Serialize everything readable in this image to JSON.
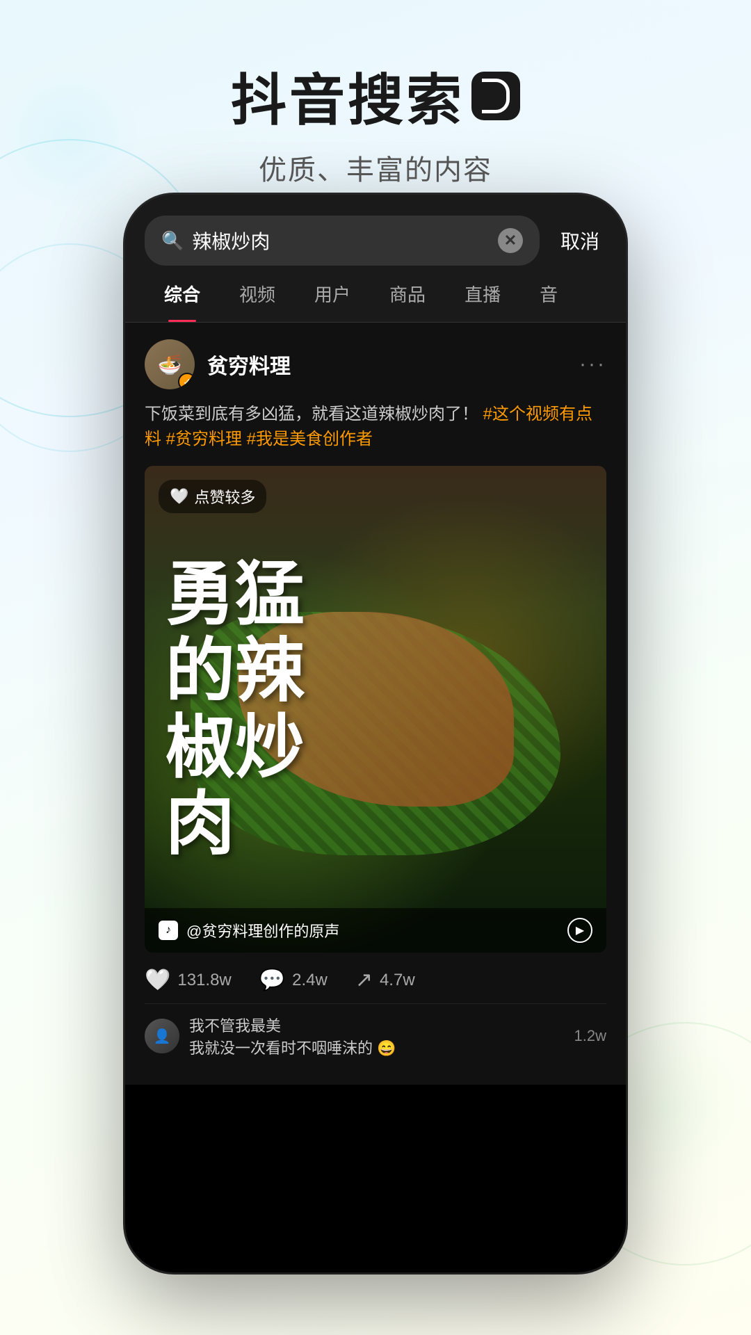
{
  "page": {
    "background": "light-gradient"
  },
  "header": {
    "title": "抖音搜索",
    "title_icon": "tiktok-logo",
    "subtitle": "优质、丰富的内容"
  },
  "phone": {
    "search": {
      "placeholder": "辣椒炒肉",
      "cancel_label": "取消"
    },
    "tabs": [
      {
        "label": "综合",
        "active": true
      },
      {
        "label": "视频",
        "active": false
      },
      {
        "label": "用户",
        "active": false
      },
      {
        "label": "商品",
        "active": false
      },
      {
        "label": "直播",
        "active": false
      },
      {
        "label": "音",
        "active": false
      }
    ],
    "post": {
      "user": {
        "name": "贫穷料理",
        "verified": true
      },
      "description": "下饭菜到底有多凶猛，就看这道辣椒炒肉了！",
      "hashtags": [
        "#这个视频有点料",
        "#贫穷料理",
        "#我是美食创作者"
      ],
      "video": {
        "likes_badge": "点赞较多",
        "big_text": "勇猛的辣椒炒肉",
        "audio_text": "@贫穷料理创作的原声"
      },
      "interactions": {
        "likes": "131.8w",
        "comments": "2.4w",
        "shares": "4.7w"
      },
      "comments": [
        {
          "user": "我不管我最美",
          "text": "我就没一次看时不咽唾沫的 😄",
          "count": "1.2w"
        }
      ]
    }
  }
}
